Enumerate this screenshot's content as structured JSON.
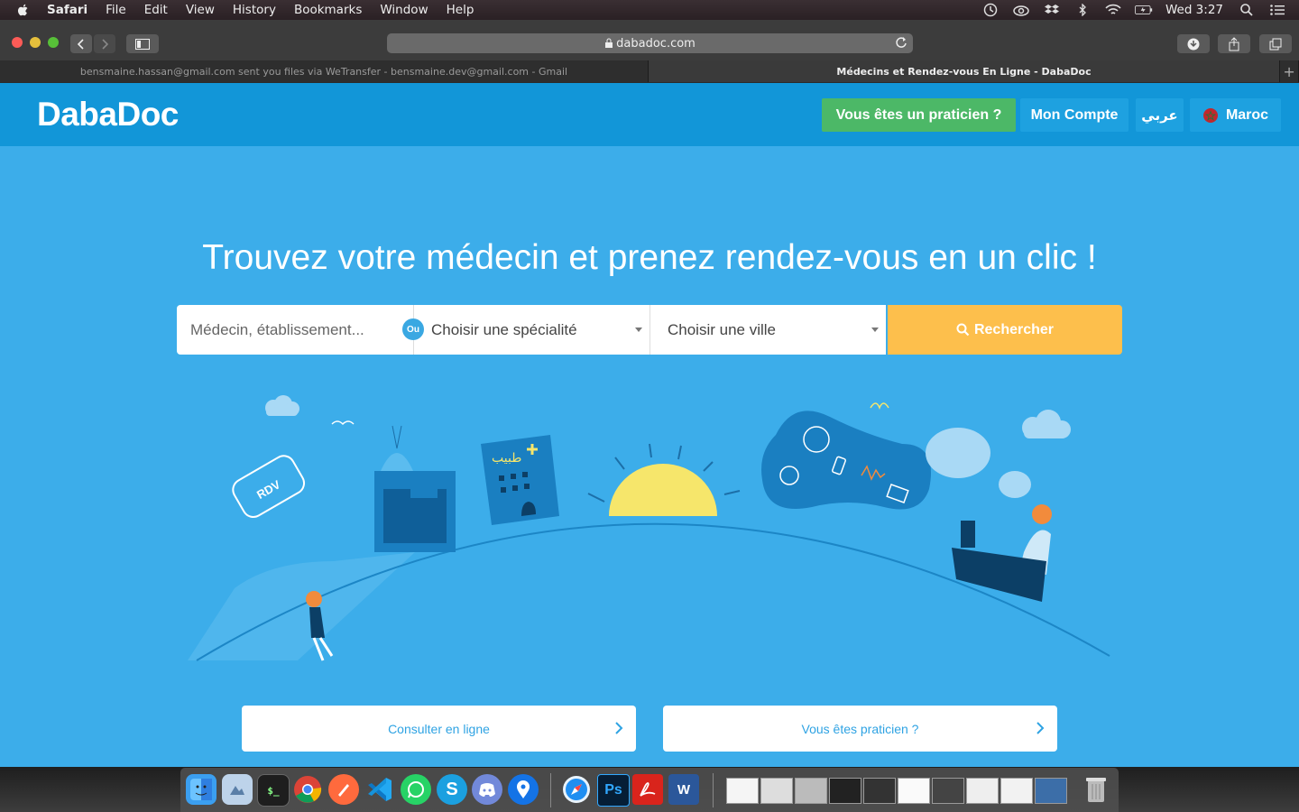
{
  "menubar": {
    "app": "Safari",
    "items": [
      "File",
      "Edit",
      "View",
      "History",
      "Bookmarks",
      "Window",
      "Help"
    ],
    "clock": "Wed 3:27"
  },
  "browser": {
    "url": "dabadoc.com",
    "tabs": [
      {
        "title": "bensmaine.hassan@gmail.com sent you files via WeTransfer - bensmaine.dev@gmail.com - Gmail",
        "active": false
      },
      {
        "title": "Médecins et Rendez-vous En Ligne - DabaDoc",
        "active": true
      }
    ],
    "new_tab": "+"
  },
  "header": {
    "logo": "DabaDoc",
    "practitioner_button": "Vous êtes un praticien ?",
    "account_button": "Mon Compte",
    "arabic_button": "عربي",
    "country_button": "Maroc"
  },
  "hero": {
    "title": "Trouvez votre médecin et prenez rendez-vous en un clic !"
  },
  "search": {
    "doctor_placeholder": "Médecin, établissement...",
    "or_label": "Ou",
    "specialty": "Choisir une spécialité",
    "city": "Choisir une ville",
    "button": "Rechercher"
  },
  "illustration": {
    "rdv_label": "RDV",
    "clinic_label": "طبيب"
  },
  "cta": {
    "consult": "Consulter en ligne",
    "practitioner": "Vous êtes praticien ?"
  },
  "colors": {
    "header_bg": "#1296d8",
    "page_bg": "#3cadea",
    "green_button": "#4cb867",
    "search_button": "#fdbf4c"
  }
}
